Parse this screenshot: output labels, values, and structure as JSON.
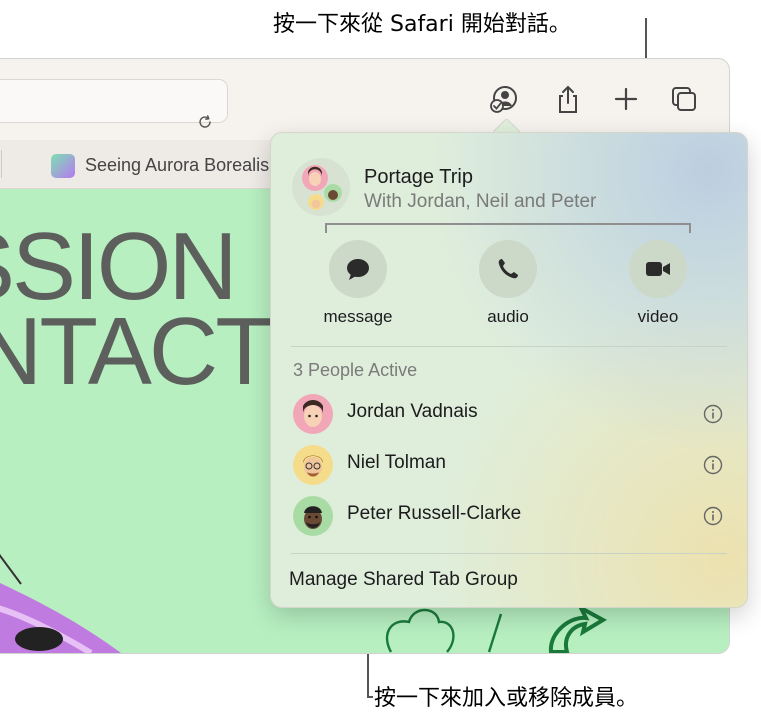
{
  "callouts": {
    "top": "按一下來從 Safari 開始對話。",
    "bottom": "按一下來加入或移除成員。"
  },
  "browser": {
    "tab_title": "Seeing Aurora Borealis",
    "page_heading_line1": "SSION",
    "page_heading_line2": "NTACT",
    "toolbar_icons": [
      "shareplay-icon",
      "share-icon",
      "new-tab-icon",
      "tab-overview-icon"
    ]
  },
  "popover": {
    "group_name": "Portage Trip",
    "group_members": "With Jordan, Neil and Peter",
    "actions": [
      {
        "label": "message",
        "icon": "message-icon"
      },
      {
        "label": "audio",
        "icon": "phone-icon"
      },
      {
        "label": "video",
        "icon": "video-icon"
      }
    ],
    "people_active": "3 People Active",
    "people": [
      {
        "name": "Jordan Vadnais",
        "avatar_color": "#f2a7b8"
      },
      {
        "name": "Niel Tolman",
        "avatar_color": "#f5dc8a"
      },
      {
        "name": "Peter Russell-Clarke",
        "avatar_color": "#a9dca5"
      }
    ],
    "manage_label": "Manage Shared Tab Group"
  }
}
